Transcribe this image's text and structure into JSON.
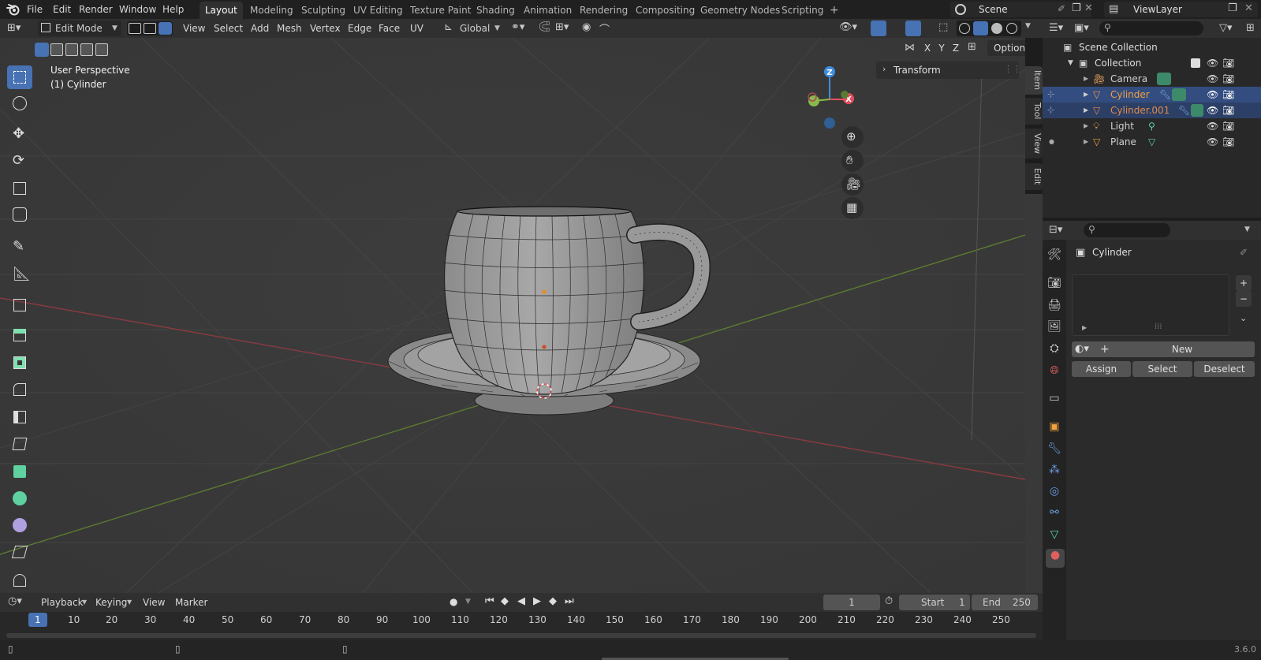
{
  "topbar": {
    "menus": [
      "File",
      "Edit",
      "Render",
      "Window",
      "Help"
    ],
    "workspaces": [
      "Layout",
      "Modeling",
      "Sculpting",
      "UV Editing",
      "Texture Paint",
      "Shading",
      "Animation",
      "Rendering",
      "Compositing",
      "Geometry Nodes",
      "Scripting"
    ],
    "active_workspace": "Layout",
    "add_workspace": "+",
    "scene": "Scene",
    "view_layer": "ViewLayer"
  },
  "header": {
    "mode": "Edit Mode",
    "menus": [
      "View",
      "Select",
      "Add",
      "Mesh",
      "Vertex",
      "Edge",
      "Face",
      "UV"
    ],
    "transform_orientation": "Global",
    "options": "Options",
    "axis_x": "X",
    "axis_y": "Y",
    "axis_z": "Z"
  },
  "viewport": {
    "perspective": "User Perspective",
    "object": "(1) Cylinder",
    "transform_panel": "Transform",
    "gizmo": {
      "x": "X",
      "y": "Y",
      "z": "Z"
    },
    "sidebar_tabs": [
      "Item",
      "Tool",
      "View",
      "Edit"
    ]
  },
  "outliner": {
    "root": "Scene Collection",
    "collection": "Collection",
    "items": [
      {
        "name": "Camera",
        "color": "#d0d0d0",
        "selected": false
      },
      {
        "name": "Cylinder",
        "color": "#f0a040",
        "selected": true
      },
      {
        "name": "Cylinder.001",
        "color": "#e08b4a",
        "selected": true
      },
      {
        "name": "Light",
        "color": "#d0d0d0",
        "selected": false
      },
      {
        "name": "Plane",
        "color": "#d0d0d0",
        "selected": false
      }
    ]
  },
  "properties": {
    "object_name": "Cylinder",
    "new_button": "New",
    "assign_button": "Assign",
    "select_button": "Select",
    "deselect_button": "Deselect",
    "add_slot": "+",
    "remove_slot": "−",
    "new_plus": "+"
  },
  "timeline": {
    "menus": [
      "Playback",
      "Keying",
      "View",
      "Marker"
    ],
    "current_frame": "1",
    "start_label": "Start",
    "start": "1",
    "end_label": "End",
    "end": "250",
    "ruler": [
      "1",
      "10",
      "20",
      "30",
      "40",
      "50",
      "60",
      "70",
      "80",
      "90",
      "100",
      "110",
      "120",
      "130",
      "140",
      "150",
      "160",
      "170",
      "180",
      "190",
      "200",
      "210",
      "220",
      "230",
      "240",
      "250"
    ]
  },
  "status": {
    "version": "3.6.0"
  },
  "colors": {
    "accent": "#4772b3",
    "axis_x": "#e44d5f",
    "axis_y": "#89b94a",
    "axis_z": "#3f8ee0",
    "object_orange": "#f0a040"
  }
}
